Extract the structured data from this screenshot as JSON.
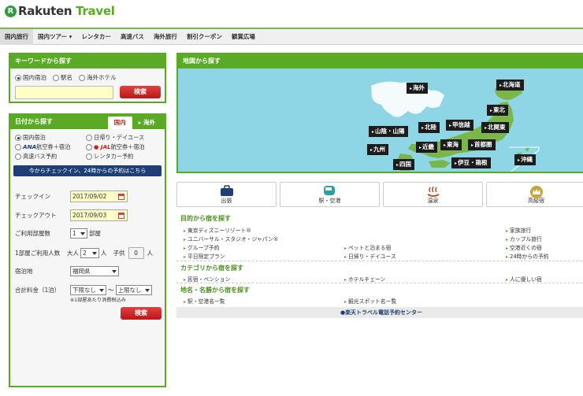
{
  "logo": {
    "mark": "R",
    "brand": "Rakuten",
    "product": " Travel"
  },
  "nav": [
    "国内旅行",
    "国内ツアー ▾",
    "レンタカー",
    "高速バス",
    "海外旅行",
    "割引クーポン",
    "観賞広場"
  ],
  "keyword": {
    "title": "キーワードから探す",
    "options": [
      "国内宿泊",
      "駅名",
      "海外ホテル"
    ],
    "search_label": "検索"
  },
  "date_search": {
    "title": "日付から探す",
    "tab_domestic": "国内",
    "tab_overseas": "海外",
    "types": {
      "domestic_stay": "国内宿泊",
      "daytrip": "日帰り・デイユース",
      "ana_brand": "ANA",
      "ana_text": "航空券＋宿泊",
      "jal_brand": "JAL",
      "jal_text": "航空券＋宿泊",
      "bus": "高速バス予約",
      "rental": "レンタカー予約"
    },
    "notice": "今からチェックイン、24時からの予約はこちら",
    "checkin_label": "チェックイン",
    "checkin_value": "2017/09/02",
    "checkout_label": "チェックアウト",
    "checkout_value": "2017/09/03",
    "rooms_label": "ご利用部屋数",
    "rooms_value": "1",
    "rooms_unit": "部屋",
    "people_label": "1部屋ご利用人数",
    "adult_label": "大人",
    "adult_value": "2",
    "adult_unit": "人",
    "child_label": "子供",
    "child_value": "0",
    "child_unit": "人",
    "location_label": "宿泊地",
    "location_value": "福岡県",
    "price_label": "合計料金（1泊）",
    "price_min": "下限なし",
    "price_tilde": "〜",
    "price_max": "上限なし",
    "price_note": "※1部屋あたり消費税込み",
    "search_label": "検索"
  },
  "map": {
    "title": "地図から探す",
    "regions": {
      "overseas": "海外",
      "hokkaido": "北海道",
      "tohoku": "東北",
      "hokuriku": "北陸",
      "koshinetsu": "甲信越",
      "kitakanto": "北関東",
      "sanin": "山陰・山陽",
      "kyushu": "九州",
      "kinki": "近畿",
      "tokai": "東海",
      "shutoken": "首都圏",
      "shikoku": "四国",
      "izu": "伊豆・箱根",
      "okinawa": "沖縄"
    }
  },
  "categories": [
    "出張",
    "駅・空港",
    "温泉",
    "高級宿"
  ],
  "purpose": {
    "title": "目的から宿を探す",
    "links": [
      "東京ディズニーリゾート®",
      "ユニバーサル・スタジオ・ジャパン®",
      "グループ予約",
      "平日限定プラン",
      "ペットと泊まる宿",
      "日帰り・デイユース",
      "家族旅行",
      "カップル旅行",
      "空港近くの宿",
      "24時からの予約"
    ]
  },
  "category": {
    "title": "カテゴリから宿を探す",
    "links": [
      "民宿・ペンション",
      "ホテルチェーン",
      "人に優しい宿"
    ]
  },
  "place": {
    "title": "地名・名勝から宿を探す",
    "links": [
      "駅・空港名一覧",
      "観光スポット名一覧"
    ]
  },
  "phone_center": "●楽天トラベル電話予約センター",
  "colors": {
    "brand_green": "#5aaa25",
    "search_red": "#c8231c",
    "map_sea": "#8ed6e6",
    "land": "#7ab648"
  }
}
